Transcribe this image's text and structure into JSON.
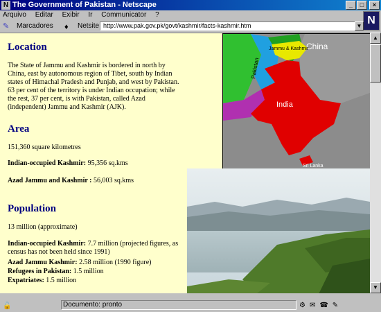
{
  "window": {
    "title": "The Government of Pakistan - Netscape",
    "buttons": [
      "_",
      "□",
      "×"
    ]
  },
  "menu": {
    "items": [
      "Arquivo",
      "Editar",
      "Exibir",
      "Ir",
      "Communicator",
      "?"
    ]
  },
  "location": {
    "bookmarks_label": "Marcadores",
    "netsite_label": "Netsite:",
    "url": "http://www.pak.gov.pk/govt/kashmir/facts-kashmir.htm"
  },
  "page": {
    "location": {
      "heading": "Location",
      "text": "The State of Jammu and Kashmir is bordered in north by China, east by autonomous region of Tibet, south by Indian states of Himachal Pradesh and Punjab, and west by Pakistan. 63 per cent of the territory is under Indian occupation; while the rest, 37 per cent, is with Pakistan, called Azad (independent) Jammu and Kashmir (AJK)."
    },
    "area": {
      "heading": "Area",
      "total": "151,360 square kilometres",
      "indian_label": "Indian-occupied Kashmir:",
      "indian_value": " 95,356 sq.kms",
      "azad_label": "Azad Jammu and Kashmir :",
      "azad_value": " 56,003 sq.kms"
    },
    "population": {
      "heading": "Population",
      "total": "13 million (approximate)",
      "indian_label": "Indian-occupied Kashmir:",
      "indian_value": " 7.7 million (projected figures, as census has not been held since 1991)",
      "azad_label": "Azad Jammu Kashmir:",
      "azad_value": " 2.58 million (1990 figure)",
      "refugees_label": "Refugees in Pakistan:",
      "refugees_value": " 1.5 million",
      "expatriates_label": "Expatriates:",
      "expatriates_value": " 1.5 million"
    },
    "map": {
      "labels": [
        "China",
        "India",
        "Jammu & Kashmir",
        "Pakistan",
        "Sri Lanka"
      ]
    }
  },
  "status": {
    "text": "Documento: pronto"
  },
  "colors": {
    "titlebar": "#000080",
    "page_background": "#ffffcc",
    "heading": "#000080"
  }
}
